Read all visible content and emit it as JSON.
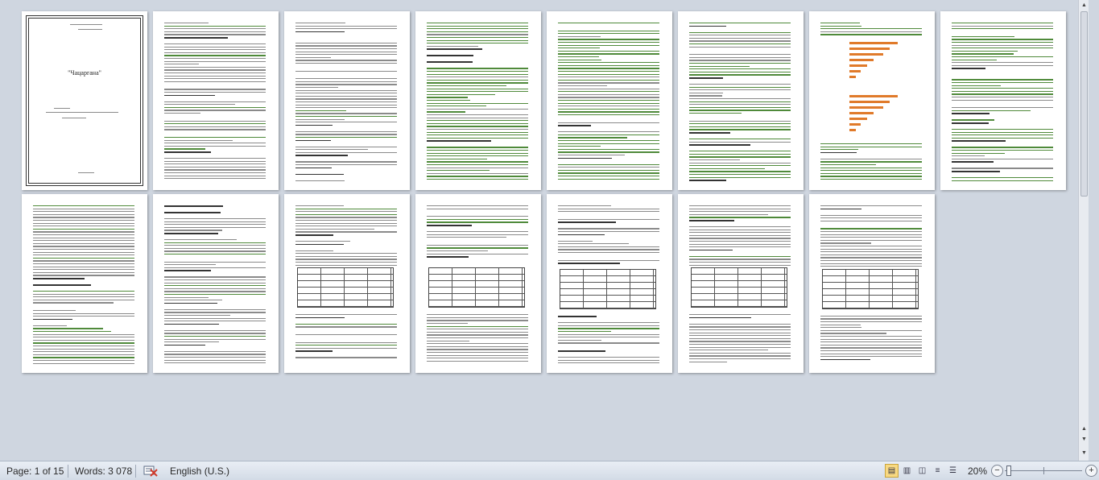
{
  "document": {
    "title_page_text": "\"Чацаргана\"",
    "page_count": 15
  },
  "status_bar": {
    "page_label": "Page: 1 of 15",
    "words_label": "Words: 3 078",
    "language": "English (U.S.)",
    "zoom_label": "20%",
    "zoom_percent": 20
  },
  "view_buttons": [
    {
      "name": "print-layout-view-button",
      "glyph": "▤",
      "active": true
    },
    {
      "name": "full-screen-reading-view-button",
      "glyph": "▥",
      "active": false
    },
    {
      "name": "web-layout-view-button",
      "glyph": "◫",
      "active": false
    },
    {
      "name": "outline-view-button",
      "glyph": "≡",
      "active": false
    },
    {
      "name": "draft-view-button",
      "glyph": "☰",
      "active": false
    }
  ],
  "colors": {
    "workspace": "#cfd6e0",
    "text_line": "#8a8a8a",
    "spellcheck_green": "#4f8a3a",
    "chart_bar": "#e07a2a",
    "active_view": "#f8d982"
  }
}
